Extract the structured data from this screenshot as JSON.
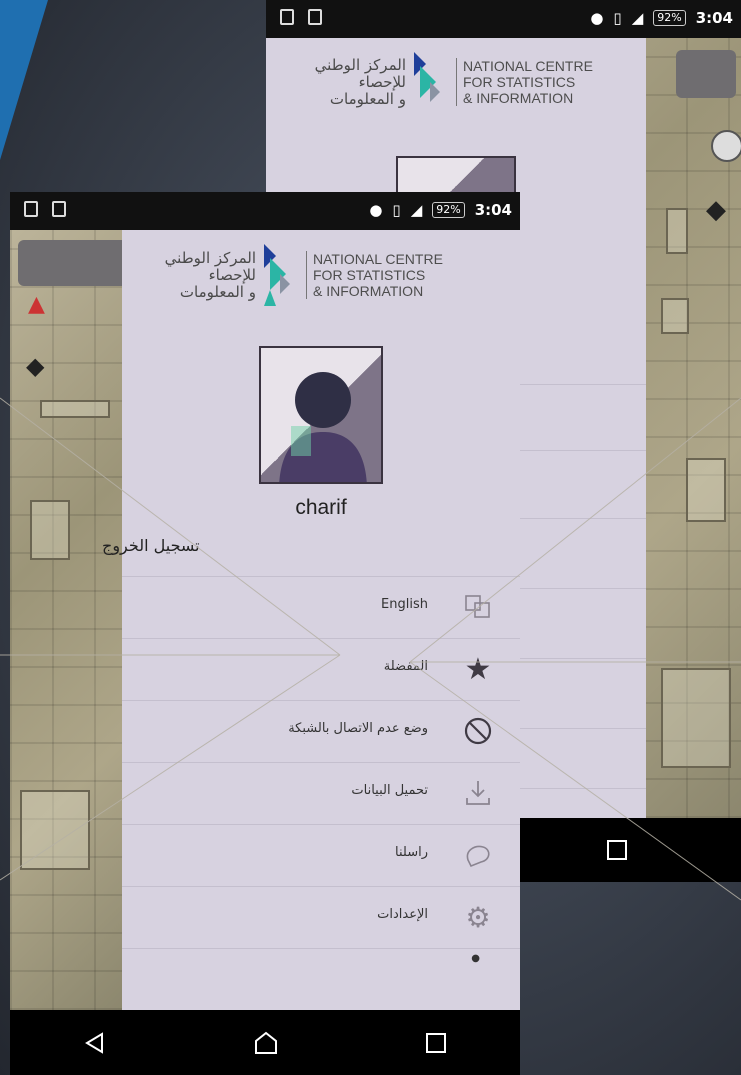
{
  "status_bar": {
    "time": "3:04",
    "battery": "92%"
  },
  "logo": {
    "arabic_lines": [
      "المركز الوطني",
      "للإحصاء",
      "و المعلومات"
    ],
    "english_lines": [
      "NATIONAL CENTRE",
      "FOR STATISTICS",
      "& INFORMATION"
    ]
  },
  "user": {
    "name": "charif"
  },
  "logout_label": "تسجيل الخروج",
  "menu": [
    {
      "label": "English",
      "icon": "language-icon"
    },
    {
      "label": "المفضلة",
      "icon": "star-icon"
    },
    {
      "label": "وضع عدم الاتصال بالشبكة",
      "icon": "offline-icon"
    },
    {
      "label": "تحميل البيانات",
      "icon": "download-icon"
    },
    {
      "label": "راسلنا",
      "icon": "chat-icon"
    },
    {
      "label": "الإعدادات",
      "icon": "settings-icon"
    }
  ],
  "nav": {
    "back": "back-icon",
    "home": "home-icon",
    "recents": "recents-icon"
  },
  "colors": {
    "drawer": "#d7d2e0",
    "accent_blue": "#1f6fb0",
    "statusbar": "#111111"
  }
}
